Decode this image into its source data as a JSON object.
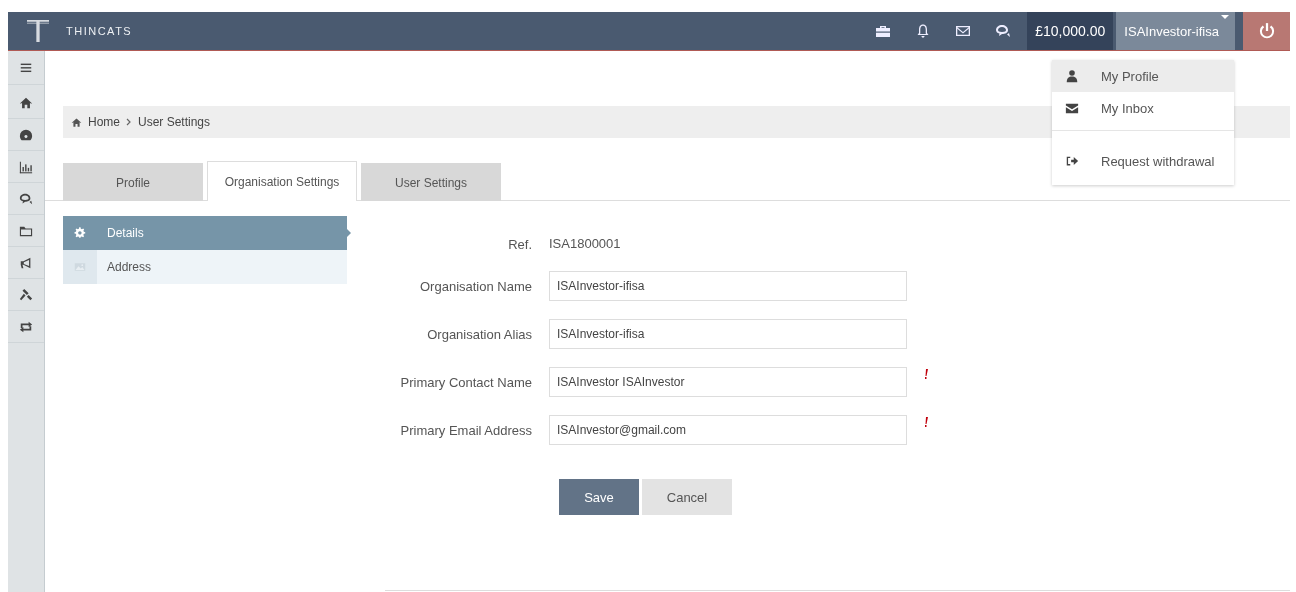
{
  "header": {
    "brand": "THINCATS",
    "balance": "£10,000.00",
    "user": "ISAInvestor-ifisa"
  },
  "user_menu": [
    {
      "label": "My Profile",
      "selected": true,
      "separated": false
    },
    {
      "label": "My Inbox",
      "selected": false,
      "separated": false
    },
    {
      "label": "Request withdrawal",
      "selected": false,
      "separated": true
    }
  ],
  "breadcrumb": [
    "Home",
    "User Settings"
  ],
  "tabs": [
    {
      "label": "Profile",
      "selected": false
    },
    {
      "label": "Organisation Settings",
      "selected": true
    },
    {
      "label": "User Settings",
      "selected": false
    }
  ],
  "section_nav": [
    {
      "label": "Details",
      "selected": true
    },
    {
      "label": "Address",
      "selected": false
    }
  ],
  "form": {
    "ref": {
      "label": "Ref.",
      "value": "ISA1800001"
    },
    "fields": [
      {
        "label": "Organisation Name",
        "value": "ISAInvestor-ifisa",
        "required": false
      },
      {
        "label": "Organisation Alias",
        "value": "ISAInvestor-ifisa",
        "required": false
      },
      {
        "label": "Primary Contact Name",
        "value": "ISAInvestor ISAInvestor",
        "required": true
      },
      {
        "label": "Primary Email Address",
        "value": "ISAInvestor@gmail.com",
        "required": true
      }
    ],
    "buttons": [
      {
        "label": "Save",
        "kind": "primary"
      },
      {
        "label": "Cancel",
        "kind": "secondary"
      }
    ]
  }
}
